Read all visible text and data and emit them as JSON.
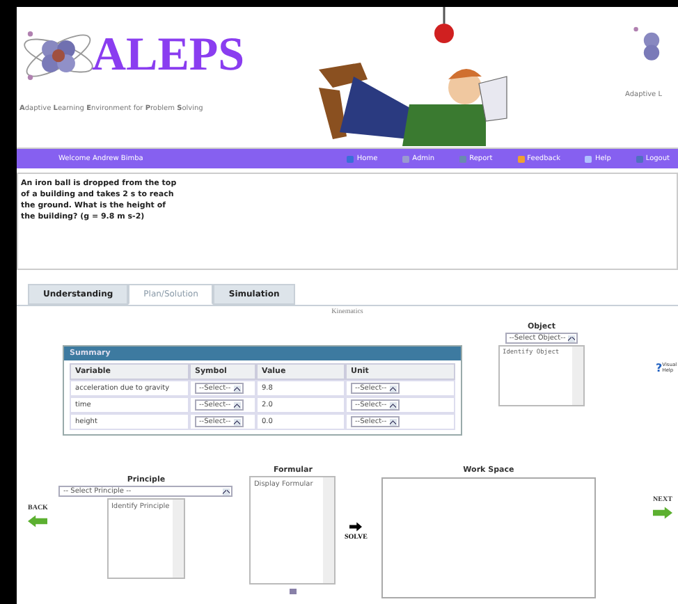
{
  "logo": {
    "title": "ALEPS",
    "tagline": "**A**daptive **L**earning **E**nvironment for **P**roblem **S**olving"
  },
  "logo_right": {
    "tagline": "Adaptive L"
  },
  "nav": {
    "welcome": "Welcome Andrew Bimba",
    "items": [
      {
        "label": "Home",
        "kind": "home"
      },
      {
        "label": "Admin",
        "kind": "admin"
      },
      {
        "label": "Report",
        "kind": "report"
      },
      {
        "label": "Feedback",
        "kind": "feedback"
      },
      {
        "label": "Help",
        "kind": "help"
      },
      {
        "label": "Logout",
        "kind": "logout"
      }
    ]
  },
  "question": "An iron ball is dropped from the top of a building and takes 2 s to reach the ground. What is the height of the building? (g = 9.8 m s-2)",
  "tabs": [
    {
      "label": "Understanding",
      "selected": false
    },
    {
      "label": "Plan/Solution",
      "selected": true
    },
    {
      "label": "Simulation",
      "selected": false
    }
  ],
  "section_title": "Kinematics",
  "summary": {
    "title": "Summary",
    "columns": [
      "Variable",
      "Symbol",
      "Value",
      "Unit"
    ],
    "rows": [
      {
        "variable": "acceleration due to gravity",
        "symbol": "--Select--",
        "value": "9.8",
        "unit": "--Select--"
      },
      {
        "variable": "time",
        "symbol": "--Select--",
        "value": "2.0",
        "unit": "--Select--"
      },
      {
        "variable": "height",
        "symbol": "--Select--",
        "value": "0.0",
        "unit": "--Select--"
      }
    ]
  },
  "object": {
    "label": "Object",
    "select": "--Select Object--",
    "list": "Identify Object"
  },
  "visual_help_icon": "?",
  "visual_help": "Visual Help",
  "principle": {
    "label": "Principle",
    "select": "-- Select Principle --",
    "list": "Identify Principle"
  },
  "formular": {
    "label": "Formular",
    "list": "Display Formular"
  },
  "solve": "SOLVE",
  "workspace": {
    "label": "Work Space"
  },
  "back": "BACK",
  "next": "NEXT"
}
